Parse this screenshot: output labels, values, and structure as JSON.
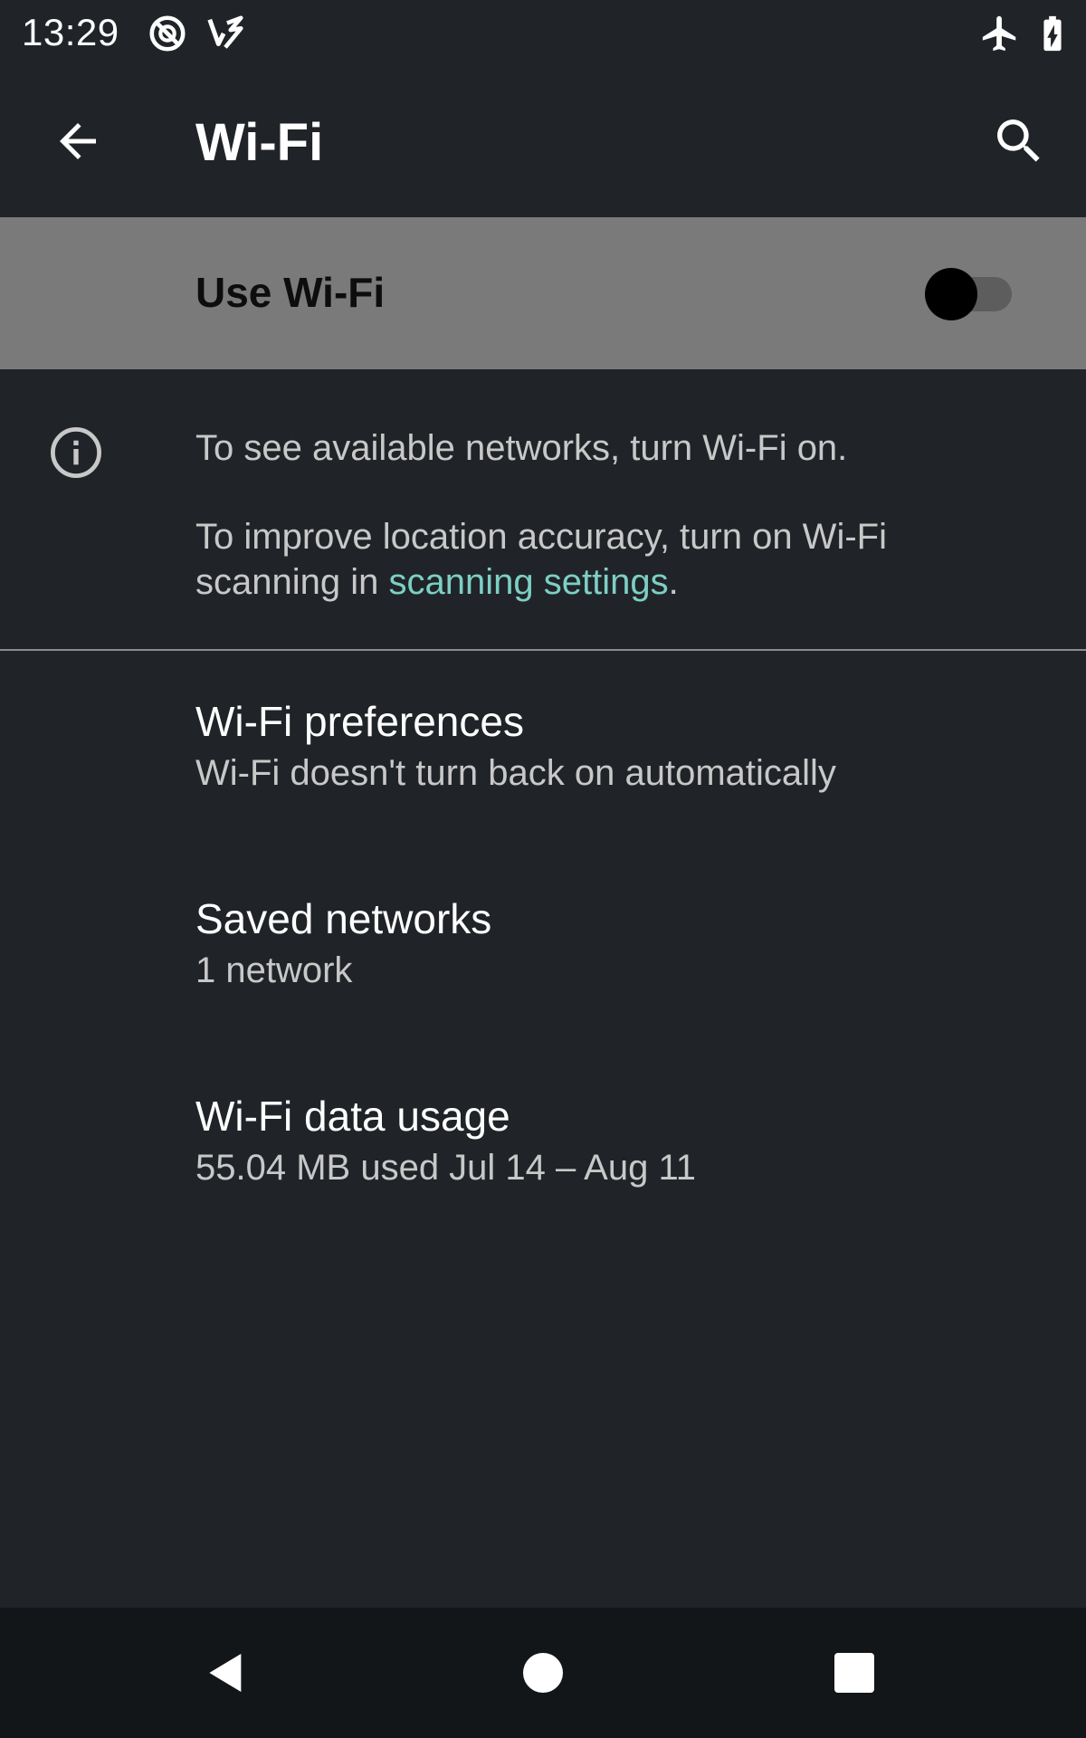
{
  "status_bar": {
    "time": "13:29",
    "icons_left": [
      "do-not-disturb-icon",
      "vpn-key-icon"
    ],
    "icons_right": [
      "airplane-mode-icon",
      "battery-charging-icon"
    ]
  },
  "app_bar": {
    "title": "Wi-Fi",
    "back_icon": "arrow-back-icon",
    "search_icon": "search-icon"
  },
  "master_switch": {
    "label": "Use Wi-Fi",
    "state": "off"
  },
  "info": {
    "icon": "info-icon",
    "line1": "To see available networks, turn Wi-Fi on.",
    "line2_prefix": "To improve location accuracy, turn on Wi-Fi scanning in ",
    "line2_link": "scanning settings",
    "line2_suffix": "."
  },
  "list": {
    "items": [
      {
        "title": "Wi-Fi preferences",
        "summary": "Wi-Fi doesn't turn back on automatically"
      },
      {
        "title": "Saved networks",
        "summary": "1 network"
      },
      {
        "title": "Wi-Fi data usage",
        "summary": "55.04 MB used Jul 14 – Aug 11"
      }
    ]
  },
  "nav_bar": {
    "back_icon": "nav-back-icon",
    "home_icon": "nav-home-icon",
    "recents_icon": "nav-recents-icon"
  },
  "colors": {
    "background": "#202428",
    "switch_bar": "#7a7a7a",
    "accent_link": "#7dcfc4",
    "nav_bar": "#131619"
  }
}
